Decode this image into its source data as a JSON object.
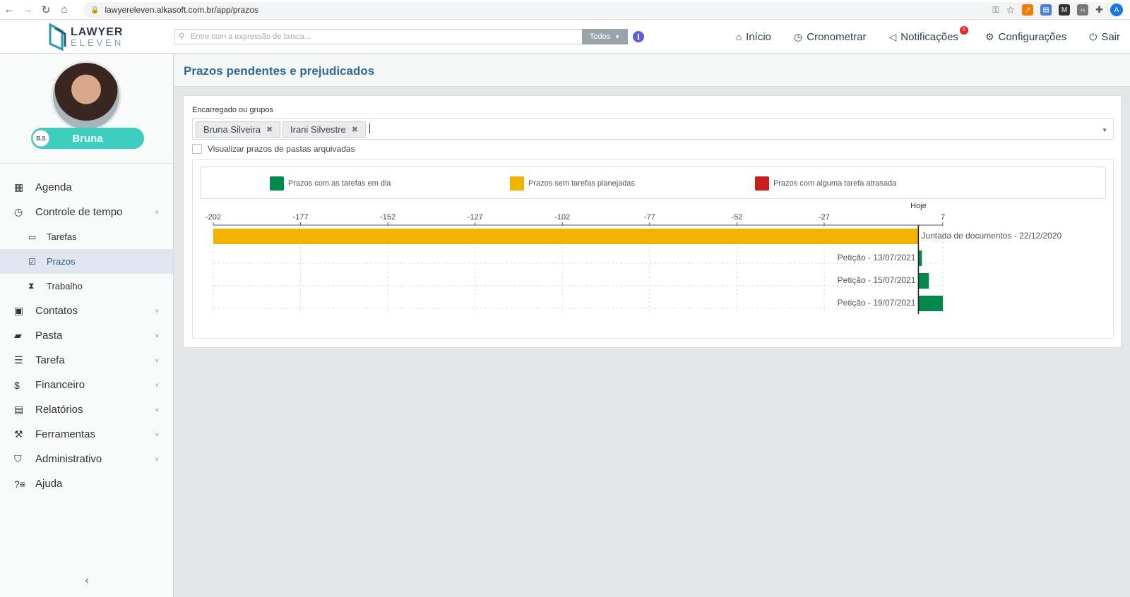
{
  "browser": {
    "url": "lawyereleven.alkasoft.com.br/app/prazos",
    "profile_initial": "A"
  },
  "header": {
    "logo_line1": "LAWYER",
    "logo_line2": "ELEVEN",
    "search_placeholder": "Entre com a expressão de busca...",
    "search_scope": "Todos",
    "nav": {
      "inicio": "Início",
      "cronometrar": "Cronometrar",
      "notificacoes": "Notificações",
      "notificacoes_count": "5",
      "configuracoes": "Configurações",
      "sair": "Sair"
    }
  },
  "sidebar": {
    "user_name": "Bruna",
    "user_initials": "B.S",
    "items": [
      {
        "label": "Agenda"
      },
      {
        "label": "Controle de tempo"
      },
      {
        "label": "Tarefas"
      },
      {
        "label": "Prazos"
      },
      {
        "label": "Trabalho"
      },
      {
        "label": "Contatos"
      },
      {
        "label": "Pasta"
      },
      {
        "label": "Tarefa"
      },
      {
        "label": "Financeiro"
      },
      {
        "label": "Relatórios"
      },
      {
        "label": "Ferramentas"
      },
      {
        "label": "Administrativo"
      },
      {
        "label": "Ajuda"
      }
    ],
    "collapse_glyph": "‹"
  },
  "page": {
    "title": "Prazos pendentes e prejudicados",
    "filter_label": "Encarregado ou grupos",
    "tags": [
      "Bruna Silveira",
      "Irani Silvestre"
    ],
    "archived_label": "Visualizar prazos de pastas arquivadas"
  },
  "colors": {
    "on_time": "#00884d",
    "unplanned": "#f0b400",
    "late": "#c81e1e"
  },
  "chart_data": {
    "type": "bar",
    "orientation": "horizontal",
    "legend": [
      {
        "label": "Prazos com as tarefas em dia",
        "color": "#00884d"
      },
      {
        "label": "Prazos sem tarefas planejadas",
        "color": "#f0b400"
      },
      {
        "label": "Prazos com alguma tarefa atrasada",
        "color": "#c81e1e"
      }
    ],
    "x_ticks": [
      -202,
      -177,
      -152,
      -127,
      -102,
      -77,
      -52,
      -27,
      7
    ],
    "xlim": [
      -202,
      7
    ],
    "reference_line": {
      "x": 0,
      "label": "Hoje"
    },
    "bars": [
      {
        "label": "Juntada de documentos - 22/12/2020",
        "start": -202,
        "end": 0,
        "status": "unplanned"
      },
      {
        "label": "Petição - 13/07/2021",
        "start": 0,
        "end": 1,
        "status": "on_time"
      },
      {
        "label": "Petição - 15/07/2021",
        "start": 0,
        "end": 3,
        "status": "on_time"
      },
      {
        "label": "Petição - 19/07/2021",
        "start": 0,
        "end": 7,
        "status": "on_time"
      }
    ],
    "grid": true
  }
}
